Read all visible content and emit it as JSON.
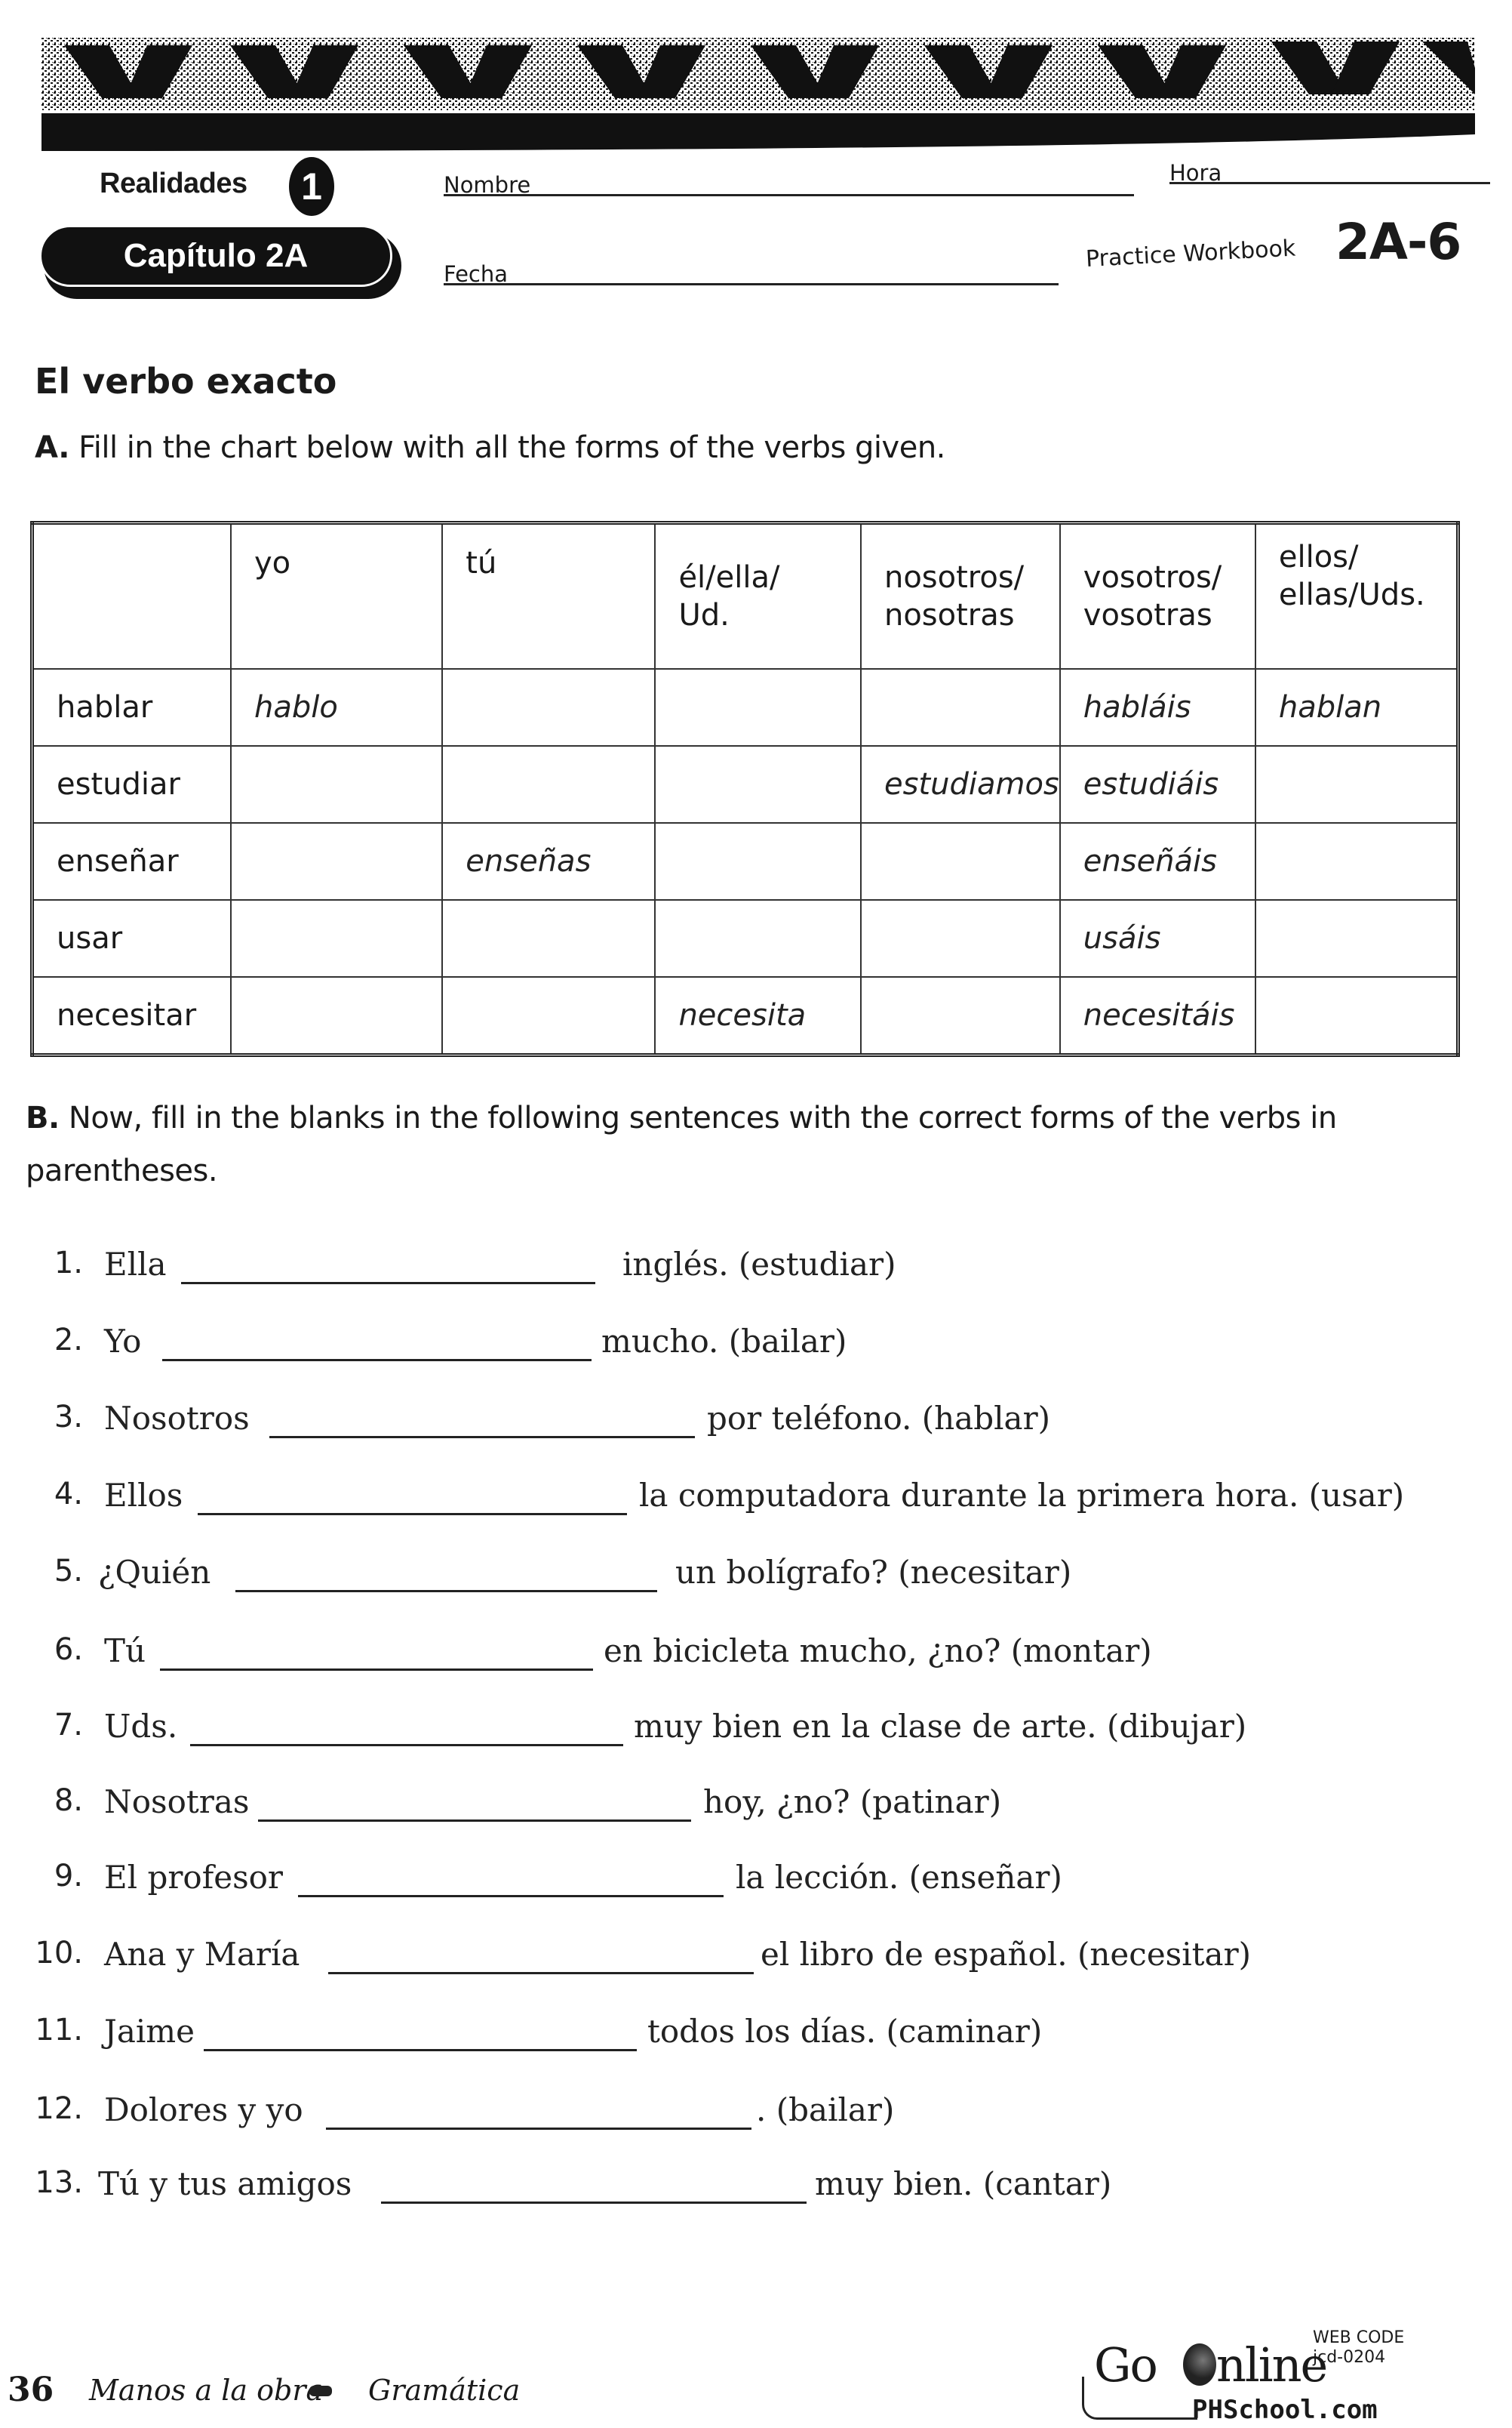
{
  "header": {
    "series": "Realidades",
    "level": "1",
    "chapter": "Capítulo 2A",
    "name_label": "Nombre",
    "name_value": "",
    "hour_label": "Hora",
    "hour_value": "",
    "date_label": "Fecha",
    "date_value": "",
    "workbook_label": "Practice Workbook",
    "workbook_code": "2A-6"
  },
  "section": {
    "title": "El verbo exacto",
    "part_a_letter": "A.",
    "part_a_instructions": "Fill in the chart below with all the forms of the verbs given.",
    "part_b_letter": "B.",
    "part_b_instructions_line1": "Now, fill in the blanks in the following sentences with the correct forms of the verbs in",
    "part_b_instructions_line2": "parentheses."
  },
  "verb_table": {
    "columns": [
      "",
      "yo",
      "tú",
      "él/ella/\nUd.",
      "nosotros/\nnosotras",
      "vosotros/\nvosotras",
      "ellos/\nellas/Uds."
    ],
    "rows": [
      {
        "verb": "hablar",
        "cells": [
          "hablo",
          "",
          "",
          "",
          "habláis",
          "hablan"
        ]
      },
      {
        "verb": "estudiar",
        "cells": [
          "",
          "",
          "",
          "estudiamos",
          "estudiáis",
          ""
        ]
      },
      {
        "verb": "enseñar",
        "cells": [
          "",
          "enseñas",
          "",
          "",
          "enseñáis",
          ""
        ]
      },
      {
        "verb": "usar",
        "cells": [
          "",
          "",
          "",
          "",
          "usáis",
          ""
        ]
      },
      {
        "verb": "necesitar",
        "cells": [
          "",
          "",
          "necesita",
          "",
          "necesitáis",
          ""
        ]
      }
    ]
  },
  "sentences": [
    {
      "number": "1.",
      "subject": "Ella",
      "answer": "",
      "rest": "inglés. (estudiar)"
    },
    {
      "number": "2.",
      "subject": "Yo",
      "answer": "",
      "rest": "mucho. (bailar)"
    },
    {
      "number": "3.",
      "subject": "Nosotros",
      "answer": "",
      "rest": "por teléfono. (hablar)"
    },
    {
      "number": "4.",
      "subject": "Ellos",
      "answer": "",
      "rest": "la computadora durante la primera hora. (usar)"
    },
    {
      "number": "5.",
      "subject": "¿Quién",
      "answer": "",
      "rest": "un bolígrafo? (necesitar)"
    },
    {
      "number": "6.",
      "subject": "Tú",
      "answer": "",
      "rest": "en bicicleta mucho, ¿no? (montar)"
    },
    {
      "number": "7.",
      "subject": "Uds.",
      "answer": "",
      "rest": "muy bien en la clase de arte. (dibujar)"
    },
    {
      "number": "8.",
      "subject": "Nosotras",
      "answer": "",
      "rest": "hoy, ¿no? (patinar)"
    },
    {
      "number": "9.",
      "subject": "El profesor",
      "answer": "",
      "rest": "la lección. (enseñar)"
    },
    {
      "number": "10.",
      "subject": "Ana y María",
      "answer": "",
      "rest": "el libro de español. (necesitar)"
    },
    {
      "number": "11.",
      "subject": "Jaime",
      "answer": "",
      "rest": "todos los días. (caminar)"
    },
    {
      "number": "12.",
      "subject": "Dolores y yo",
      "answer": "",
      "rest": ". (bailar)"
    },
    {
      "number": "13.",
      "subject": "Tú y tus amigos",
      "answer": "",
      "rest": "muy bien. (cantar)"
    }
  ],
  "footer": {
    "page_number": "36",
    "section_text": "Manos a la obra",
    "topic_text": "Gramática",
    "go_online_prefix": "Go",
    "go_online_suffix": "nline",
    "web_code_label": "WEB CODE",
    "web_code": "jcd-0204",
    "site": "PHSchool.com"
  }
}
